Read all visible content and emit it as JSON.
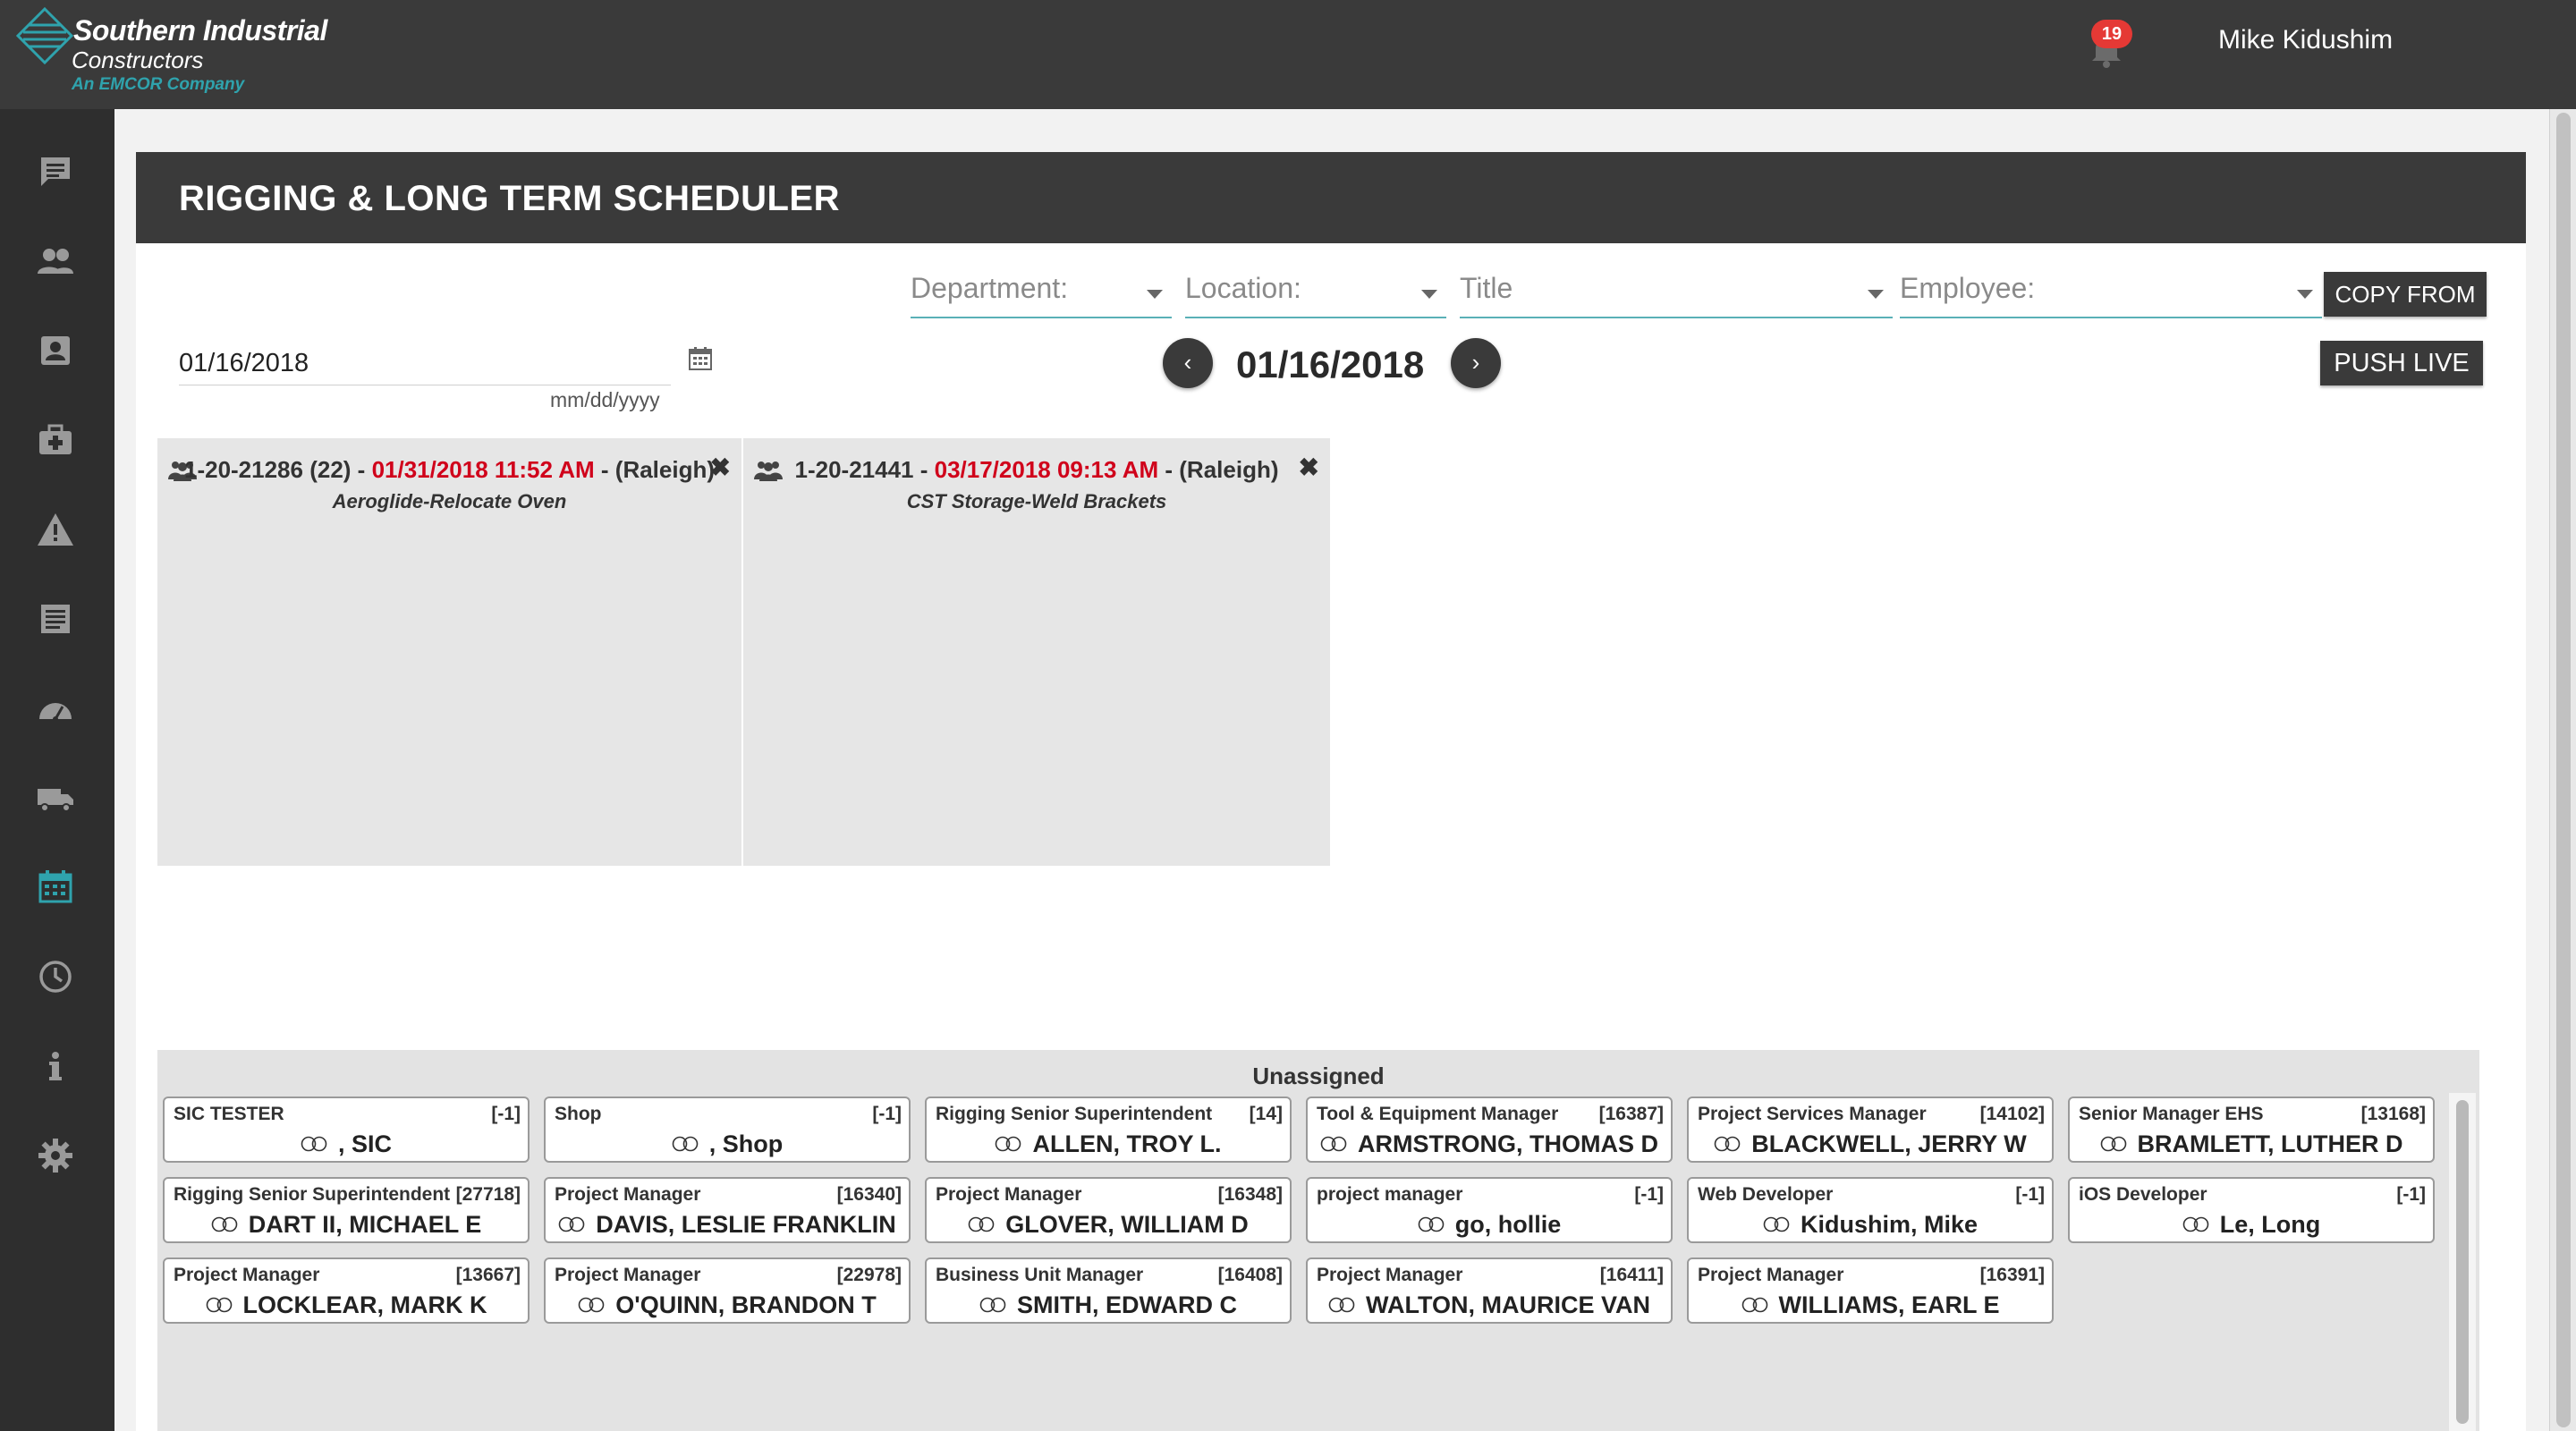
{
  "brand": {
    "company": "Southern Industrial",
    "line2": "Constructors",
    "tagline": "An EMCOR Company",
    "accent_color": "#2fa3ad"
  },
  "header": {
    "notification_count": "19",
    "user_name": "Mike Kidushim"
  },
  "sidebar": {
    "items": [
      {
        "icon": "comments-icon"
      },
      {
        "icon": "people-icon"
      },
      {
        "icon": "contact-card-icon"
      },
      {
        "icon": "medical-kit-icon"
      },
      {
        "icon": "warning-icon"
      },
      {
        "icon": "document-list-icon"
      },
      {
        "icon": "dashboard-gauge-icon"
      },
      {
        "icon": "truck-icon"
      },
      {
        "icon": "calendar-icon",
        "active": true
      },
      {
        "icon": "clock-icon"
      },
      {
        "icon": "info-icon"
      },
      {
        "icon": "gear-icon"
      }
    ]
  },
  "page": {
    "title": "RIGGING & LONG TERM SCHEDULER"
  },
  "filters": {
    "department": "Department:",
    "location": "Location:",
    "title": "Title",
    "employee": "Employee:"
  },
  "actions": {
    "copy_from": "COPY FROM",
    "push_live": "PUSH LIVE"
  },
  "date_picker": {
    "value": "01/16/2018",
    "hint": "mm/dd/yyyy",
    "current_date": "01/16/2018",
    "prev": "‹",
    "next": "›"
  },
  "jobs": [
    {
      "number": "1-20-21286 (22)",
      "due": "01/31/2018 11:52 AM",
      "location": "(Raleigh)",
      "description": "Aeroglide-Relocate Oven",
      "sep": " - "
    },
    {
      "number": "1-20-21441",
      "due": "03/17/2018 09:13 AM",
      "location": "(Raleigh)",
      "description": "CST Storage-Weld Brackets",
      "sep": " - "
    }
  ],
  "unassigned": {
    "title": "Unassigned",
    "employees": [
      {
        "title": "SIC TESTER",
        "id": "[-1]",
        "name": ", SIC"
      },
      {
        "title": "Shop",
        "id": "[-1]",
        "name": ", Shop"
      },
      {
        "title": "Rigging Senior Superintendent",
        "id": "[14]",
        "name": "ALLEN, TROY L."
      },
      {
        "title": "Tool & Equipment Manager",
        "id": "[16387]",
        "name": "ARMSTRONG, THOMAS D"
      },
      {
        "title": "Project Services Manager",
        "id": "[14102]",
        "name": "BLACKWELL, JERRY W"
      },
      {
        "title": "Senior Manager EHS",
        "id": "[13168]",
        "name": "BRAMLETT, LUTHER D"
      },
      {
        "title": "Rigging Senior Superintendent",
        "id": "[27718]",
        "name": "DART II, MICHAEL E"
      },
      {
        "title": "Project Manager",
        "id": "[16340]",
        "name": "DAVIS, LESLIE FRANKLIN"
      },
      {
        "title": "Project Manager",
        "id": "[16348]",
        "name": "GLOVER, WILLIAM D"
      },
      {
        "title": "project manager",
        "id": "[-1]",
        "name": "go, hollie"
      },
      {
        "title": "Web Developer",
        "id": "[-1]",
        "name": "Kidushim, Mike"
      },
      {
        "title": "iOS Developer",
        "id": "[-1]",
        "name": "Le, Long"
      },
      {
        "title": "Project Manager",
        "id": "[13667]",
        "name": "LOCKLEAR, MARK K"
      },
      {
        "title": "Project Manager",
        "id": "[22978]",
        "name": "O'QUINN, BRANDON T"
      },
      {
        "title": "Business Unit Manager",
        "id": "[16408]",
        "name": "SMITH, EDWARD C"
      },
      {
        "title": "Project Manager",
        "id": "[16411]",
        "name": "WALTON, MAURICE VAN"
      },
      {
        "title": "Project Manager",
        "id": "[16391]",
        "name": "WILLIAMS, EARL E"
      }
    ]
  }
}
